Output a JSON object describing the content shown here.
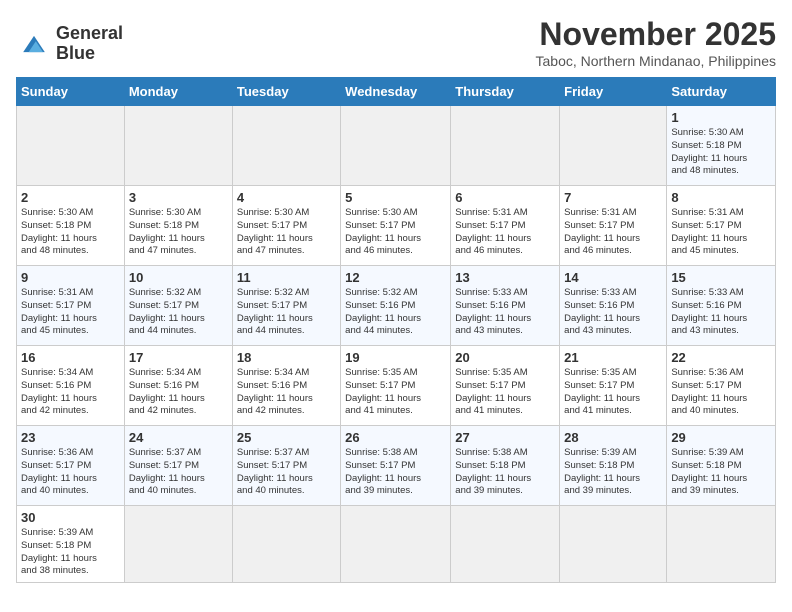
{
  "header": {
    "logo_general": "General",
    "logo_blue": "Blue",
    "month_title": "November 2025",
    "location": "Taboc, Northern Mindanao, Philippines"
  },
  "days_of_week": [
    "Sunday",
    "Monday",
    "Tuesday",
    "Wednesday",
    "Thursday",
    "Friday",
    "Saturday"
  ],
  "weeks": [
    [
      {
        "day": "",
        "info": ""
      },
      {
        "day": "",
        "info": ""
      },
      {
        "day": "",
        "info": ""
      },
      {
        "day": "",
        "info": ""
      },
      {
        "day": "",
        "info": ""
      },
      {
        "day": "",
        "info": ""
      },
      {
        "day": "1",
        "info": "Sunrise: 5:30 AM\nSunset: 5:18 PM\nDaylight: 11 hours\nand 48 minutes."
      }
    ],
    [
      {
        "day": "2",
        "info": "Sunrise: 5:30 AM\nSunset: 5:18 PM\nDaylight: 11 hours\nand 48 minutes."
      },
      {
        "day": "3",
        "info": "Sunrise: 5:30 AM\nSunset: 5:18 PM\nDaylight: 11 hours\nand 47 minutes."
      },
      {
        "day": "4",
        "info": "Sunrise: 5:30 AM\nSunset: 5:17 PM\nDaylight: 11 hours\nand 47 minutes."
      },
      {
        "day": "5",
        "info": "Sunrise: 5:30 AM\nSunset: 5:17 PM\nDaylight: 11 hours\nand 46 minutes."
      },
      {
        "day": "6",
        "info": "Sunrise: 5:31 AM\nSunset: 5:17 PM\nDaylight: 11 hours\nand 46 minutes."
      },
      {
        "day": "7",
        "info": "Sunrise: 5:31 AM\nSunset: 5:17 PM\nDaylight: 11 hours\nand 46 minutes."
      },
      {
        "day": "8",
        "info": "Sunrise: 5:31 AM\nSunset: 5:17 PM\nDaylight: 11 hours\nand 45 minutes."
      }
    ],
    [
      {
        "day": "9",
        "info": "Sunrise: 5:31 AM\nSunset: 5:17 PM\nDaylight: 11 hours\nand 45 minutes."
      },
      {
        "day": "10",
        "info": "Sunrise: 5:32 AM\nSunset: 5:17 PM\nDaylight: 11 hours\nand 44 minutes."
      },
      {
        "day": "11",
        "info": "Sunrise: 5:32 AM\nSunset: 5:17 PM\nDaylight: 11 hours\nand 44 minutes."
      },
      {
        "day": "12",
        "info": "Sunrise: 5:32 AM\nSunset: 5:16 PM\nDaylight: 11 hours\nand 44 minutes."
      },
      {
        "day": "13",
        "info": "Sunrise: 5:33 AM\nSunset: 5:16 PM\nDaylight: 11 hours\nand 43 minutes."
      },
      {
        "day": "14",
        "info": "Sunrise: 5:33 AM\nSunset: 5:16 PM\nDaylight: 11 hours\nand 43 minutes."
      },
      {
        "day": "15",
        "info": "Sunrise: 5:33 AM\nSunset: 5:16 PM\nDaylight: 11 hours\nand 43 minutes."
      }
    ],
    [
      {
        "day": "16",
        "info": "Sunrise: 5:34 AM\nSunset: 5:16 PM\nDaylight: 11 hours\nand 42 minutes."
      },
      {
        "day": "17",
        "info": "Sunrise: 5:34 AM\nSunset: 5:16 PM\nDaylight: 11 hours\nand 42 minutes."
      },
      {
        "day": "18",
        "info": "Sunrise: 5:34 AM\nSunset: 5:16 PM\nDaylight: 11 hours\nand 42 minutes."
      },
      {
        "day": "19",
        "info": "Sunrise: 5:35 AM\nSunset: 5:17 PM\nDaylight: 11 hours\nand 41 minutes."
      },
      {
        "day": "20",
        "info": "Sunrise: 5:35 AM\nSunset: 5:17 PM\nDaylight: 11 hours\nand 41 minutes."
      },
      {
        "day": "21",
        "info": "Sunrise: 5:35 AM\nSunset: 5:17 PM\nDaylight: 11 hours\nand 41 minutes."
      },
      {
        "day": "22",
        "info": "Sunrise: 5:36 AM\nSunset: 5:17 PM\nDaylight: 11 hours\nand 40 minutes."
      }
    ],
    [
      {
        "day": "23",
        "info": "Sunrise: 5:36 AM\nSunset: 5:17 PM\nDaylight: 11 hours\nand 40 minutes."
      },
      {
        "day": "24",
        "info": "Sunrise: 5:37 AM\nSunset: 5:17 PM\nDaylight: 11 hours\nand 40 minutes."
      },
      {
        "day": "25",
        "info": "Sunrise: 5:37 AM\nSunset: 5:17 PM\nDaylight: 11 hours\nand 40 minutes."
      },
      {
        "day": "26",
        "info": "Sunrise: 5:38 AM\nSunset: 5:17 PM\nDaylight: 11 hours\nand 39 minutes."
      },
      {
        "day": "27",
        "info": "Sunrise: 5:38 AM\nSunset: 5:18 PM\nDaylight: 11 hours\nand 39 minutes."
      },
      {
        "day": "28",
        "info": "Sunrise: 5:39 AM\nSunset: 5:18 PM\nDaylight: 11 hours\nand 39 minutes."
      },
      {
        "day": "29",
        "info": "Sunrise: 5:39 AM\nSunset: 5:18 PM\nDaylight: 11 hours\nand 39 minutes."
      }
    ],
    [
      {
        "day": "30",
        "info": "Sunrise: 5:39 AM\nSunset: 5:18 PM\nDaylight: 11 hours\nand 38 minutes."
      },
      {
        "day": "",
        "info": ""
      },
      {
        "day": "",
        "info": ""
      },
      {
        "day": "",
        "info": ""
      },
      {
        "day": "",
        "info": ""
      },
      {
        "day": "",
        "info": ""
      },
      {
        "day": "",
        "info": ""
      }
    ]
  ]
}
